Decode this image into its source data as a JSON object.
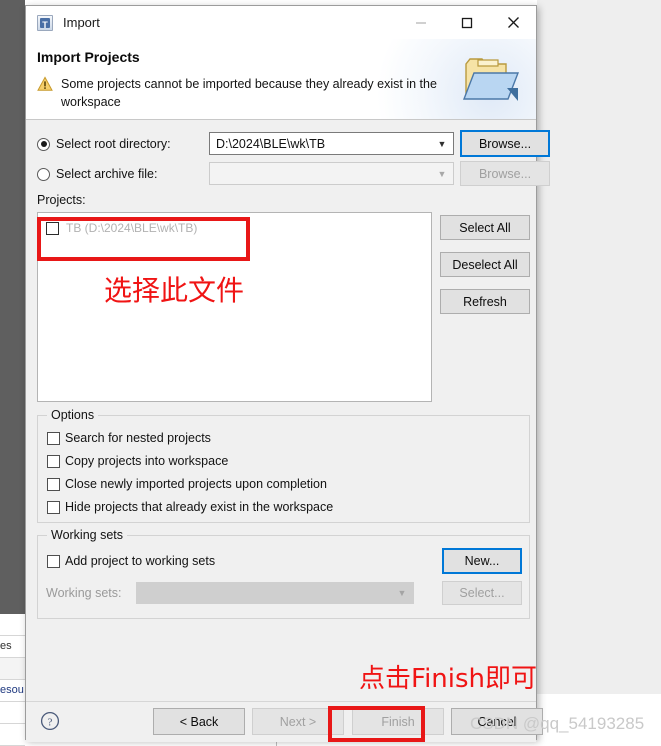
{
  "window": {
    "title": "Import",
    "icon": "eclipse-import-icon",
    "controls": {
      "minimize": "minimize-icon",
      "maximize": "maximize-icon",
      "close": "close-icon"
    }
  },
  "header": {
    "title": "Import Projects",
    "warning_icon": "warning-icon",
    "message": "Some projects cannot be imported because they already exist in the workspace",
    "banner_icon": "import-folder-icon"
  },
  "source": {
    "root_radio_label": "Select root directory:",
    "root_radio_selected": true,
    "root_value": "D:\\2024\\BLE\\wk\\TB",
    "root_browse_label": "Browse...",
    "archive_radio_label": "Select archive file:",
    "archive_radio_selected": false,
    "archive_value": "",
    "archive_browse_label": "Browse..."
  },
  "projects": {
    "label": "Projects:",
    "items": [
      {
        "label": "TB (D:\\2024\\BLE\\wk\\TB)",
        "checked": false,
        "disabled": true
      }
    ],
    "buttons": [
      {
        "label": "Select All"
      },
      {
        "label": "Deselect All"
      },
      {
        "label": "Refresh"
      }
    ]
  },
  "options": {
    "title": "Options",
    "items": [
      {
        "label": "Search for nested projects",
        "checked": false
      },
      {
        "label": "Copy projects into workspace",
        "checked": false
      },
      {
        "label": "Close newly imported projects upon completion",
        "checked": false
      },
      {
        "label": "Hide projects that already exist in the workspace",
        "checked": false
      }
    ]
  },
  "working_sets": {
    "title": "Working sets",
    "add_label": "Add project to working sets",
    "add_checked": false,
    "new_label": "New...",
    "sets_label": "Working sets:",
    "sets_value": "",
    "select_label": "Select..."
  },
  "footer": {
    "help_icon": "help-icon",
    "buttons": [
      {
        "label": "< Back",
        "disabled": false
      },
      {
        "label": "Next >",
        "disabled": true
      },
      {
        "label": "Finish",
        "disabled": true
      },
      {
        "label": "Cancel",
        "disabled": false
      }
    ]
  },
  "annotations": {
    "project_note": "选择此文件",
    "finish_note": "点击Finish即可",
    "box_color": "#e81717",
    "text_color": "#f01414"
  },
  "watermark": "CSDN @qq_54193285",
  "background": {
    "rows": [
      "",
      "es",
      "",
      "esou",
      "",
      ""
    ]
  }
}
